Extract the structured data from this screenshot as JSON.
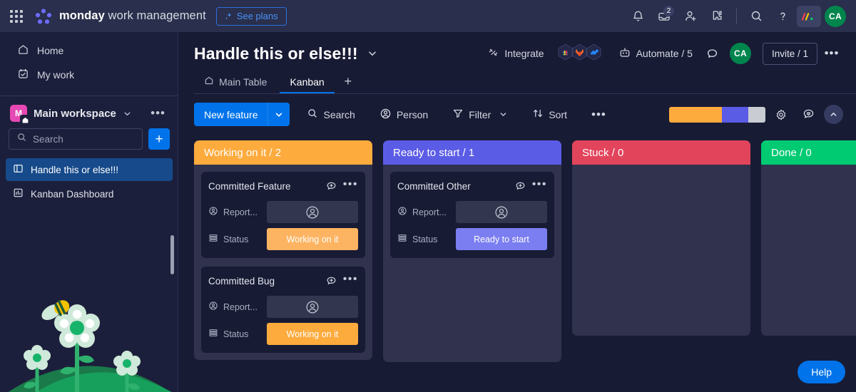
{
  "topbar": {
    "waffle_icon": "apps-grid-icon",
    "brand_bold": "monday",
    "brand_rest": " work management",
    "see_plans": "See plans",
    "notifications_icon": "bell-icon",
    "inbox_icon": "inbox-icon",
    "inbox_badge": "2",
    "invite_icon": "add-person-icon",
    "extensions_icon": "puzzle-icon",
    "search_icon": "search-icon",
    "help_icon": "question-mark-icon",
    "monday_mark_icon": "monday-logo-mark-icon",
    "avatar_initials": "CA",
    "avatar_color": "#00854d"
  },
  "sidebar": {
    "nav": [
      {
        "label": "Home",
        "icon": "home-icon"
      },
      {
        "label": "My work",
        "icon": "my-work-calendar-icon"
      }
    ],
    "workspace": {
      "initial": "M",
      "name": "Main workspace",
      "badge_color": "#e649b4",
      "caret_icon": "chevron-down-icon",
      "menu_icon": "more-options-icon"
    },
    "search": {
      "placeholder": "Search",
      "icon": "search-icon"
    },
    "add_button": "+",
    "boards": [
      {
        "label": "Handle this or else!!!",
        "icon": "board-icon",
        "active": true
      },
      {
        "label": "Kanban Dashboard",
        "icon": "dashboard-icon",
        "active": false
      }
    ]
  },
  "board": {
    "title": "Handle this or else!!!",
    "title_caret_icon": "chevron-down-icon",
    "integrate_label": "Integrate",
    "integrate_icon": "integrate-plug-icon",
    "integrations": [
      "slack-app-icon",
      "gitlab-app-icon",
      "jira-app-icon"
    ],
    "automate_label": "Automate / 5",
    "automate_icon": "robot-icon",
    "activity_icon": "comment-bubble-icon",
    "member_initials": "CA",
    "invite_label": "Invite / 1",
    "more_icon": "more-options-icon",
    "tabs": [
      {
        "label": "Main Table",
        "icon": "home-icon",
        "active": false
      },
      {
        "label": "Kanban",
        "icon": "",
        "active": true
      }
    ],
    "add_tab": "+"
  },
  "toolbar": {
    "new_item_label": "New feature",
    "new_item_caret_icon": "chevron-down-icon",
    "search_label": "Search",
    "search_icon": "search-icon",
    "person_label": "Person",
    "person_icon": "person-icon",
    "filter_label": "Filter",
    "filter_icon": "funnel-icon",
    "filter_caret_icon": "chevron-down-icon",
    "sort_label": "Sort",
    "sort_icon": "sort-arrows-icon",
    "more_icon": "more-options-icon",
    "color_segments": [
      {
        "color": "#fdab3d",
        "width": "55%"
      },
      {
        "color": "#5b5ce6",
        "width": "27%"
      },
      {
        "color": "#c9ccd2",
        "width": "18%"
      }
    ],
    "settings_icon": "gear-icon",
    "feedback_icon": "chat-heart-icon",
    "collapse_icon": "chevron-up-icon"
  },
  "kanban": {
    "columns": [
      {
        "title": "Working on it / 2",
        "color": "#fdab3d",
        "cards": [
          {
            "title": "Committed Feature",
            "add_comment_icon": "add-comment-icon",
            "menu_icon": "more-options-icon",
            "rows": [
              {
                "label": "Report...",
                "icon": "person-icon",
                "type": "person",
                "value": "",
                "color": "#32374f"
              },
              {
                "label": "Status",
                "icon": "status-icon",
                "type": "status",
                "value": "Working on it",
                "color": "#fdb462"
              }
            ]
          },
          {
            "title": "Committed Bug",
            "add_comment_icon": "add-comment-icon",
            "menu_icon": "more-options-icon",
            "rows": [
              {
                "label": "Report...",
                "icon": "person-icon",
                "type": "person",
                "value": "",
                "color": "#32374f"
              },
              {
                "label": "Status",
                "icon": "status-icon",
                "type": "status",
                "value": "Working on it",
                "color": "#fdab3d"
              }
            ]
          }
        ]
      },
      {
        "title": "Ready to start / 1",
        "color": "#5b5ce6",
        "cards": [
          {
            "title": "Committed Other",
            "add_comment_icon": "add-comment-icon",
            "menu_icon": "more-options-icon",
            "rows": [
              {
                "label": "Report...",
                "icon": "person-icon",
                "type": "person",
                "value": "",
                "color": "#32374f"
              },
              {
                "label": "Status",
                "icon": "status-icon",
                "type": "status",
                "value": "Ready to start",
                "color": "#7b7ef0"
              }
            ]
          }
        ]
      },
      {
        "title": "Stuck / 0",
        "color": "#e2445c",
        "cards": []
      },
      {
        "title": "Done / 0",
        "color": "#00ca72",
        "cards": []
      }
    ]
  },
  "help": {
    "label": "Help"
  }
}
